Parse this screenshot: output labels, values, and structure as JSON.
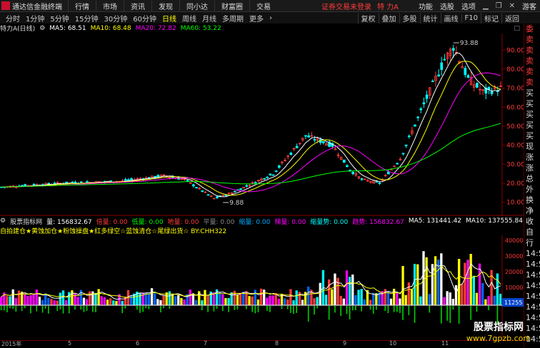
{
  "titlebar": {
    "app_name": "通达信金融终端",
    "menus": [
      "行情",
      "市场",
      "资讯",
      "发现",
      "同小达",
      "财富圈",
      "交易"
    ],
    "login_warning": "证券交易未登录",
    "stock_name": "特 力A",
    "right_menus": [
      "功能",
      "选股",
      "选项"
    ],
    "guest": "游客"
  },
  "toolbar": {
    "periods": [
      "分时",
      "1分钟",
      "5分钟",
      "15分钟",
      "30分钟",
      "60分钟",
      "日线",
      "周线",
      "月线",
      "多周期",
      "更多"
    ],
    "active_period": "日线",
    "right_tools": [
      "复权",
      "叠加",
      "多股",
      "统计",
      "画线",
      "F10",
      "标记",
      "返回"
    ]
  },
  "main_chart": {
    "stock_label": "特力A",
    "period_label": "(日线)",
    "ma_labels": [
      {
        "label": "MA5: 68.51",
        "color": "#ffffff"
      },
      {
        "label": "MA10: 68.48",
        "color": "#ffff00"
      },
      {
        "label": "MA20: 72.82",
        "color": "#ff00ff"
      },
      {
        "label": "MA60: 53.22",
        "color": "#00ff00"
      }
    ],
    "price_ticks": [
      "90.00",
      "80.00",
      "70.00",
      "60.00",
      "50.00",
      "40.00",
      "30.00",
      "20.00",
      "10.00"
    ],
    "high_label": "93.88",
    "low_label": "9.88"
  },
  "sub_chart": {
    "indicator_name": "股票指标网",
    "items": [
      {
        "label": "量: 156832.67",
        "color": "#ffffff"
      },
      {
        "label": "倍量: 0.00",
        "color": "#ff3b3b"
      },
      {
        "label": "低量: 0.00",
        "color": "#00ff00"
      },
      {
        "label": "地量: 0.00",
        "color": "#ff3b3b"
      },
      {
        "label": "平量: 0.00",
        "color": "#888888"
      },
      {
        "label": "缩量: 0.00",
        "color": "#00aaff"
      },
      {
        "label": "梯量: 0.00",
        "color": "#ff00ff"
      },
      {
        "label": "缩量势: 0.00",
        "color": "#00ffff"
      },
      {
        "label": "趋势: 156832.67",
        "color": "#ff00ff"
      },
      {
        "label": "MA5: 131441.42",
        "color": "#ffffff"
      },
      {
        "label": "MA10: 137555.84",
        "color": "#ffffff"
      }
    ],
    "formula_text": "自拍建仓★黄蚀加仓★粉蚀操盘★红多绿空☆蓝蚀清仓☆尾绿出货☆ BY:CHH322",
    "vol_ticks": [
      "40000",
      "30000",
      "20000",
      "10000"
    ],
    "marker_label": "11255"
  },
  "right_panel": {
    "items": [
      "委比",
      "卖五",
      "卖四",
      "卖三",
      "卖二",
      "卖一",
      "买一",
      "买二",
      "买三",
      "买四",
      "买五",
      "现价",
      "涨跌",
      "涨幅",
      "总量",
      "外盘",
      "换手",
      "净资",
      "收益",
      "自动",
      "行情",
      "14:5",
      "14:5",
      "14:5",
      "14:5",
      "14:5",
      "14:5",
      "14:5",
      "14:5",
      "14:5"
    ]
  },
  "date_axis": {
    "labels": [
      "2015年",
      "5",
      "6",
      "7",
      "8",
      "9",
      "10",
      "11"
    ]
  },
  "watermark": {
    "line1": "股票指标网",
    "line2": "www.7gpzb.com"
  },
  "colors": {
    "up": "#ff3b3b",
    "down": "#00ffff",
    "ma5": "#ffffff",
    "ma10": "#ffff00",
    "ma20": "#ff00ff",
    "ma60": "#00ff00"
  }
}
